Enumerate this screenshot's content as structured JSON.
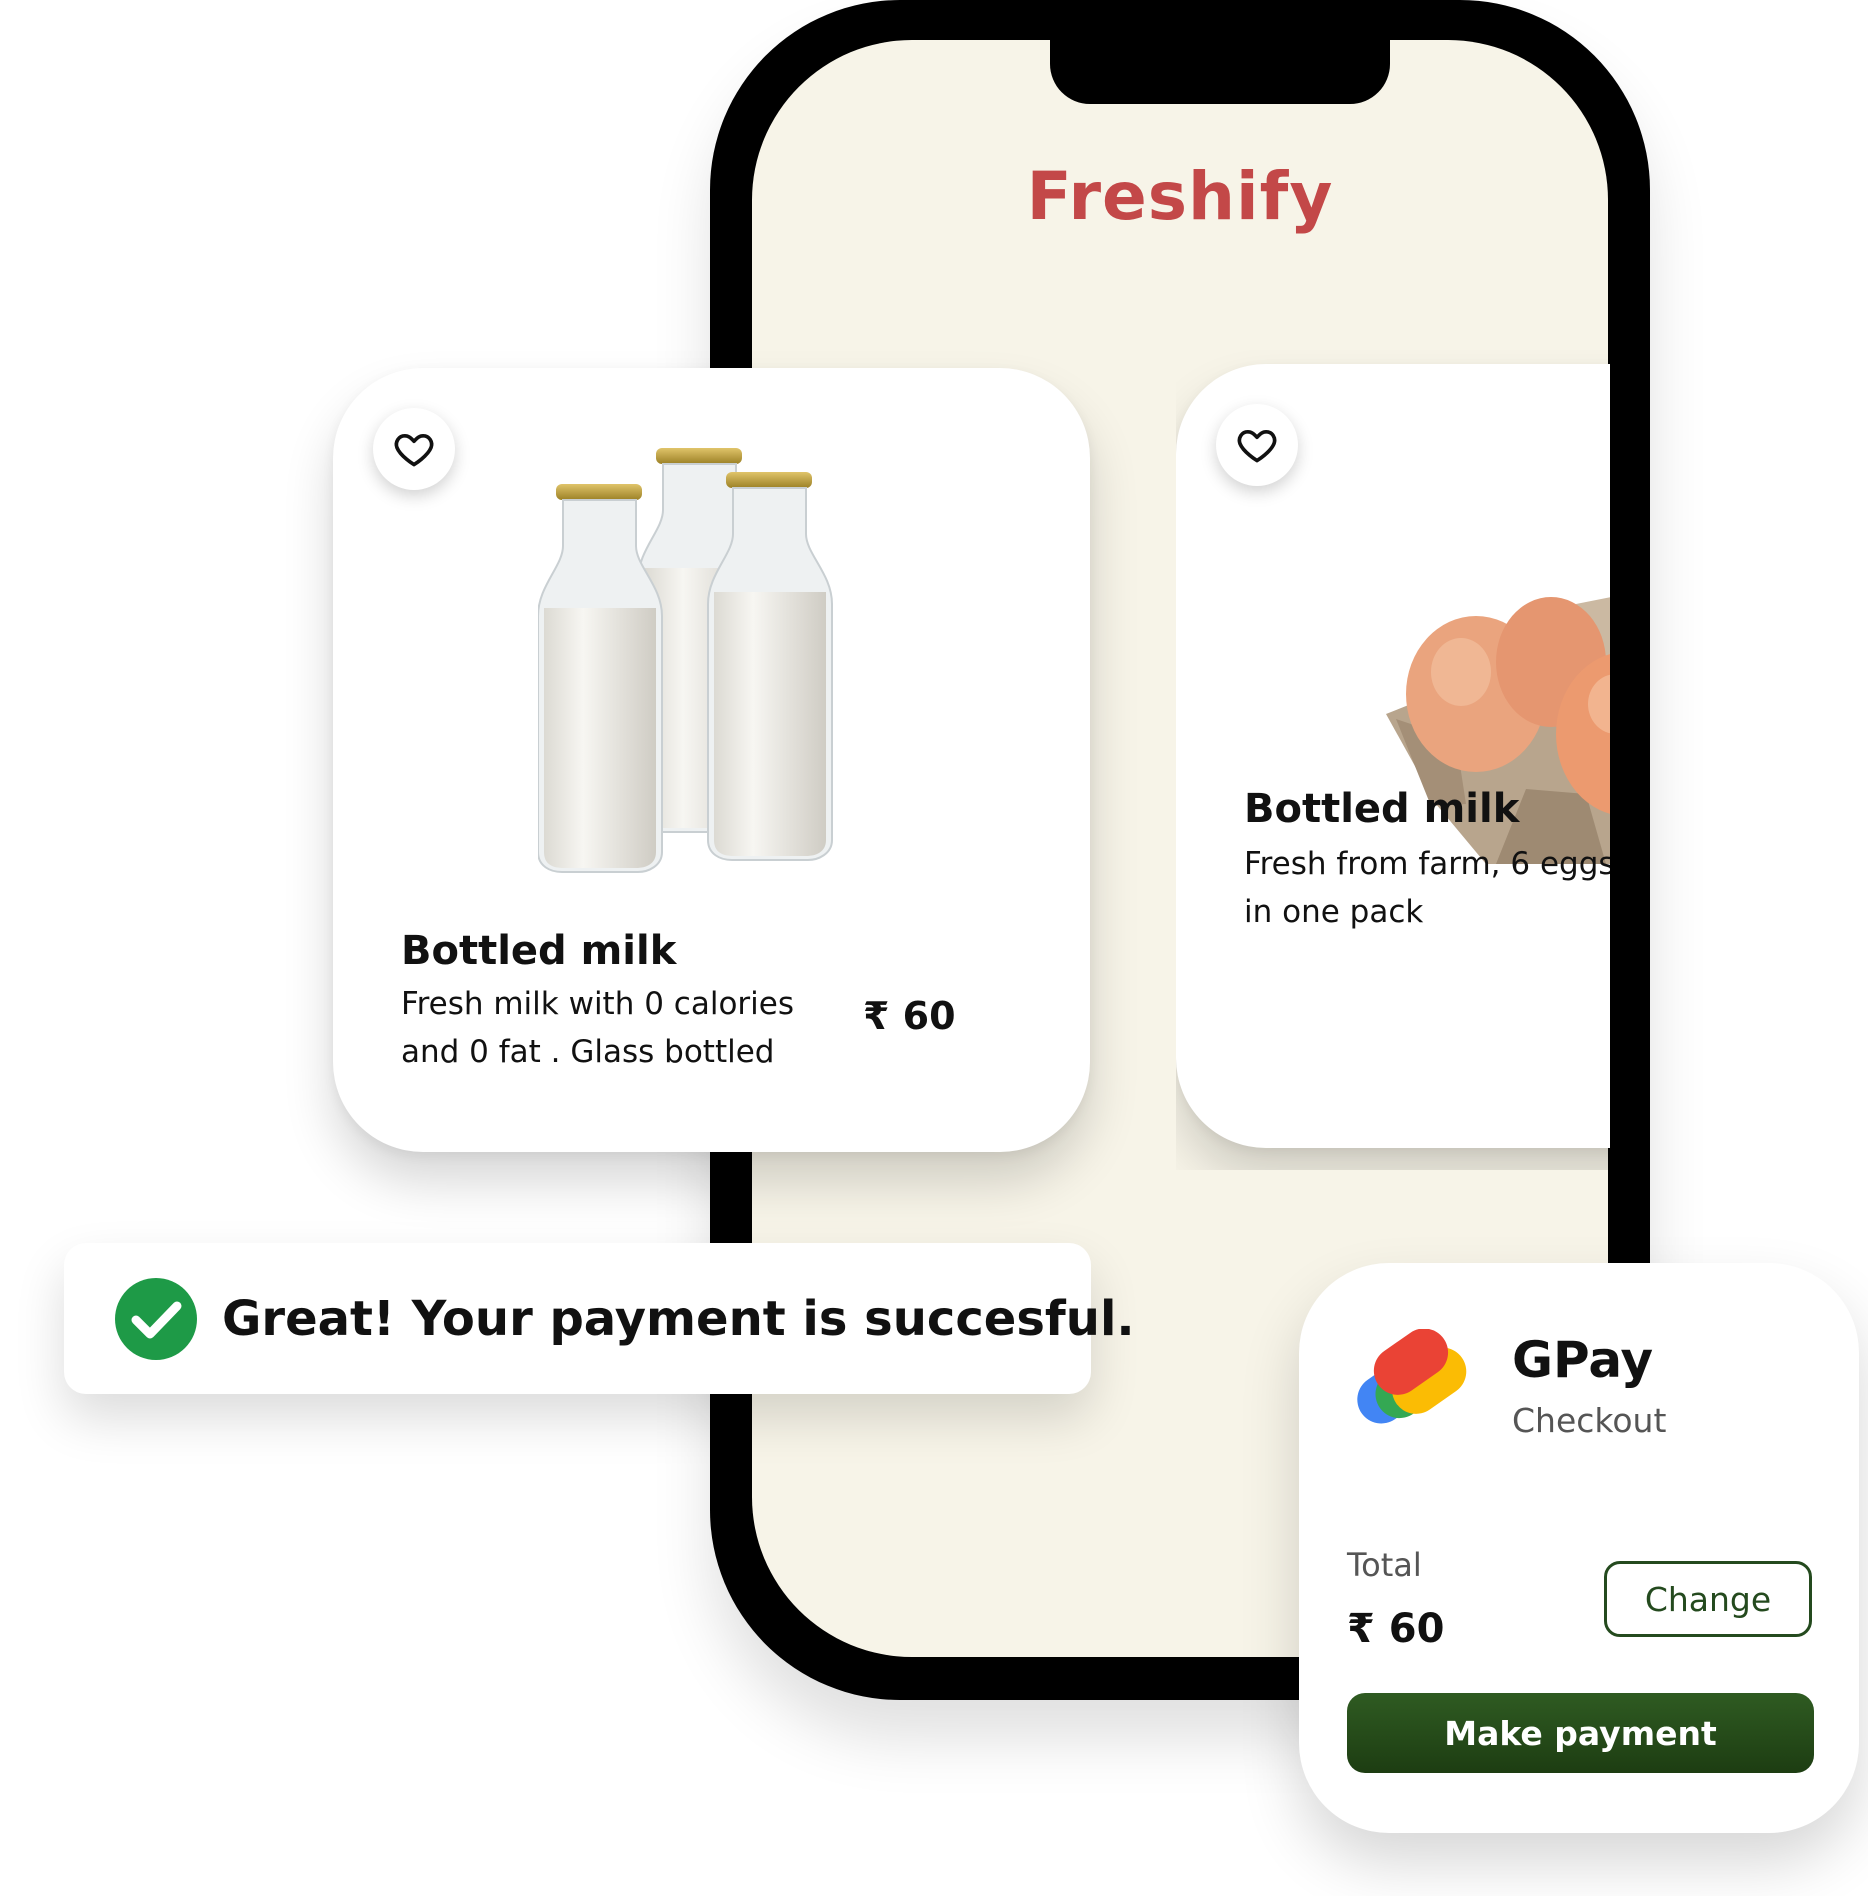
{
  "app": {
    "brand": "Freshify"
  },
  "products": [
    {
      "title": "Bottled milk",
      "desc_line1": "Fresh milk with 0 calories",
      "desc_line2": "and 0 fat . Glass bottled",
      "price": "₹ 60",
      "favorite_icon": "heart-outline-icon",
      "image": "milk-bottles"
    },
    {
      "title": "Bottled milk",
      "desc_line1": "Fresh from farm, 6 eggs",
      "desc_line2": "in one pack",
      "image": "egg-carton",
      "favorite_icon": "heart-outline-icon"
    }
  ],
  "toast": {
    "message": "Great! Your payment is succesful.",
    "icon": "check-circle-icon",
    "icon_color": "#1e9a47"
  },
  "payment": {
    "provider": "GPay",
    "subtitle": "Checkout",
    "total_label": "Total",
    "total_value": "₹ 60",
    "change_label": "Change",
    "pay_label": "Make payment",
    "accent": "#244a1e"
  },
  "colors": {
    "brand": "#c34848",
    "screen_bg": "#f7f4e8"
  }
}
